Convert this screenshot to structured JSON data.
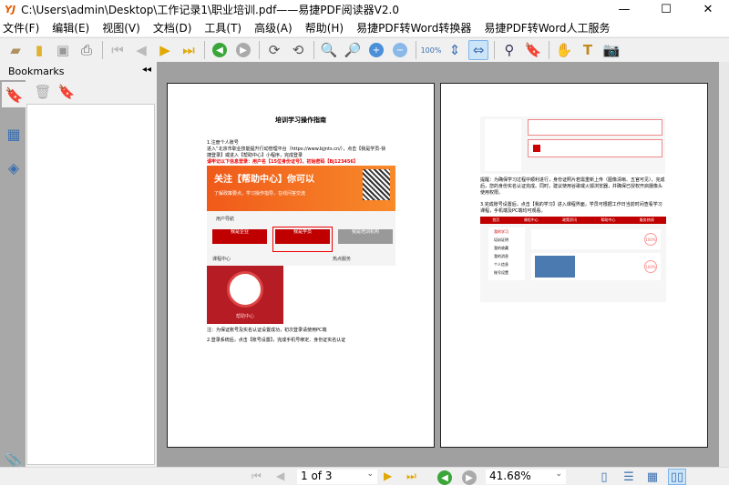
{
  "window": {
    "logo": "YJ",
    "title": "C:\\Users\\admin\\Desktop\\工作记录1\\职业培训.pdf——易捷PDF阅读器V2.0",
    "minimize": "—",
    "maximize": "☐",
    "close": "✕"
  },
  "menu": [
    "文件(F)",
    "编辑(E)",
    "视图(V)",
    "文档(D)",
    "工具(T)",
    "高级(A)",
    "帮助(H)",
    "易捷PDF转Word转换器",
    "易捷PDF转Word人工服务"
  ],
  "toolbar": {
    "active": "fit-width"
  },
  "sidebar": {
    "title": "Bookmarks",
    "collapse": "◂◂"
  },
  "page1": {
    "heading": "培训学习操作指南",
    "step1": "1.注册个人账号",
    "para1": "进入“北京市职业技能提升行动管理平台（https://www.bjjnts.cn/），点击【我是学员-快捷登录】或进入【帮助中心】小程序，完成登录",
    "red_note": "请牢记以下信息登录：用户名【15位身份证号】，初始密码【Bj123456】",
    "banner_title": "关注【帮助中心】你可以",
    "banner_sub": "了解政策要点，学习操作指导，在线问答交流",
    "nav_label": "用户导航",
    "cards": [
      "我是企业",
      "我是学员",
      "我是培训机构"
    ],
    "course_center": "课程中心",
    "hot": "热点服务",
    "mini_label": "帮助中心",
    "note": "注：为保证账号及实名认证设置成功，初次登录请使用PC端",
    "step2": "2.登录系统后，点击【账号设置】，完成手机号绑定、身份证实名认证"
  },
  "page2": {
    "para1": "提醒：为确保学习过程中顺利进行，身份证照片若需重新上传（图像清晰、五官可见），完成后，您的身份实名认证完成。同时，建议使用谷歌或火狐浏览器，并确保已授权开启摄像头使用权限。",
    "para2": "3.完成账号设置后，点击【我的学习】进入课程界面，学员可根据工作日当前时间查看学习课程，手机端及PC端均可观看。",
    "menu_items": [
      "我的学习",
      "培训证明",
      "我的收藏",
      "我的消息",
      "个人信息",
      "账号设置"
    ],
    "top_nav": [
      "首页",
      "课程中心",
      "政策资讯",
      "帮助中心",
      "服务热线"
    ],
    "progress": "100%"
  },
  "status": {
    "page": "1 of 3",
    "zoom": "41.68%",
    "view_mode": "facing"
  },
  "colors": {
    "accent": "#cce4f7",
    "red": "#c00000",
    "orange": "#f26a1b",
    "viewer_bg": "#a0a0a0"
  }
}
